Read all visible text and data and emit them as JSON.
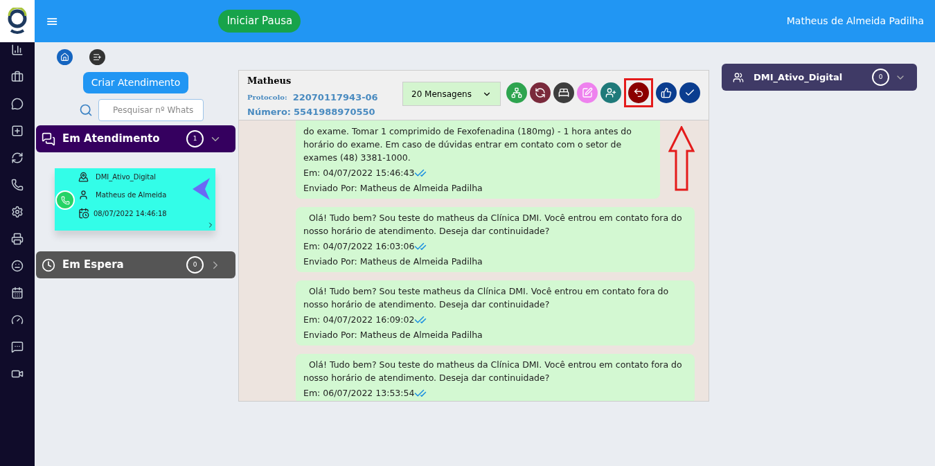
{
  "topbar": {
    "menu_icon": "≡",
    "pause_button": "Iniciar Pausa",
    "user_name": "Matheus de Almeida Padilha"
  },
  "sidebar": {
    "items": [
      {
        "kind": "chart"
      },
      {
        "kind": "briefcase"
      },
      {
        "kind": "whatsapp"
      },
      {
        "kind": "plus"
      },
      {
        "kind": "refresh"
      },
      {
        "kind": "phone"
      },
      {
        "kind": "gear"
      },
      {
        "kind": "printer"
      },
      {
        "kind": "face"
      },
      {
        "kind": "calendar"
      },
      {
        "kind": "gauge"
      },
      {
        "kind": "chat"
      },
      {
        "kind": "video"
      }
    ]
  },
  "left_panel": {
    "create_button": "Criar Atendimento",
    "search": {
      "placeholder": "Pesquisar nº Whats"
    },
    "groups": [
      {
        "kind": "active",
        "title": "Em Atendimento",
        "count": "1",
        "expanded": true,
        "cards": [
          {
            "queue": "DMI_Ativo_Digital",
            "agent": "Matheus de Almeida",
            "datetime": "08/07/2022 14:46:18"
          }
        ]
      },
      {
        "kind": "waiting",
        "title": "Em Espera",
        "count": "0",
        "expanded": false
      }
    ]
  },
  "chat": {
    "contact_name": "Matheus",
    "protocol_label": "Protocolo:",
    "protocol": "22070117943-06",
    "number_label": "Número:",
    "number": "5541988970550",
    "message_count_select": "20 Mensagens",
    "actions": [
      {
        "kind": "transfer",
        "color": "#2ea44f",
        "highlighted": false
      },
      {
        "kind": "cycle",
        "color": "#7a2a3c",
        "highlighted": false
      },
      {
        "kind": "sleep",
        "color": "#3d3d3d",
        "highlighted": false
      },
      {
        "kind": "edit",
        "color": "#ee82ee",
        "highlighted": false
      },
      {
        "kind": "add-user",
        "color": "#1f7a7a",
        "highlighted": false
      },
      {
        "kind": "reply",
        "color": "#8b0000",
        "highlighted": true
      },
      {
        "kind": "check-thumb",
        "color": "#0a3d8f",
        "highlighted": false
      },
      {
        "kind": "check",
        "color": "#0a3d8f",
        "highlighted": false
      }
    ],
    "messages": [
      {
        "text": "do exame. Tomar 1 comprimido de Fexofenadina (180mg) - 1 hora antes do horário do exame. Em caso de dúvidas entrar em contato com o setor de exames (48) 3381-1000.",
        "time": "Em: 04/07/2022 15:46:43",
        "read": true,
        "sender": "Enviado Por: Matheus de Almeida Padilha"
      },
      {
        "text": "Olá! Tudo bem? Sou teste do matheus da Clínica DMI. Você entrou em contato fora do nosso horário de atendimento. Deseja dar continuidade?",
        "time": "Em: 04/07/2022 16:03:06",
        "read": true,
        "sender": "Enviado Por: Matheus de Almeida Padilha"
      },
      {
        "text": "Olá! Tudo bem? Sou teste matheus da Clínica DMI. Você entrou em contato fora do nosso horário de atendimento. Deseja dar continuidade?",
        "time": "Em: 04/07/2022 16:09:02",
        "read": true,
        "sender": "Enviado Por: Matheus de Almeida Padilha"
      },
      {
        "text": "Olá! Tudo bem? Sou teste do matheus da Clínica DMI. Você entrou em contato fora do nosso horário de atendimento. Deseja dar continuidade?",
        "time": "Em: 06/07/2022 13:53:54",
        "read": true
      }
    ]
  },
  "queue_panel": {
    "title": "DMI_Ativo_Digital",
    "count": "0",
    "expanded": false
  }
}
